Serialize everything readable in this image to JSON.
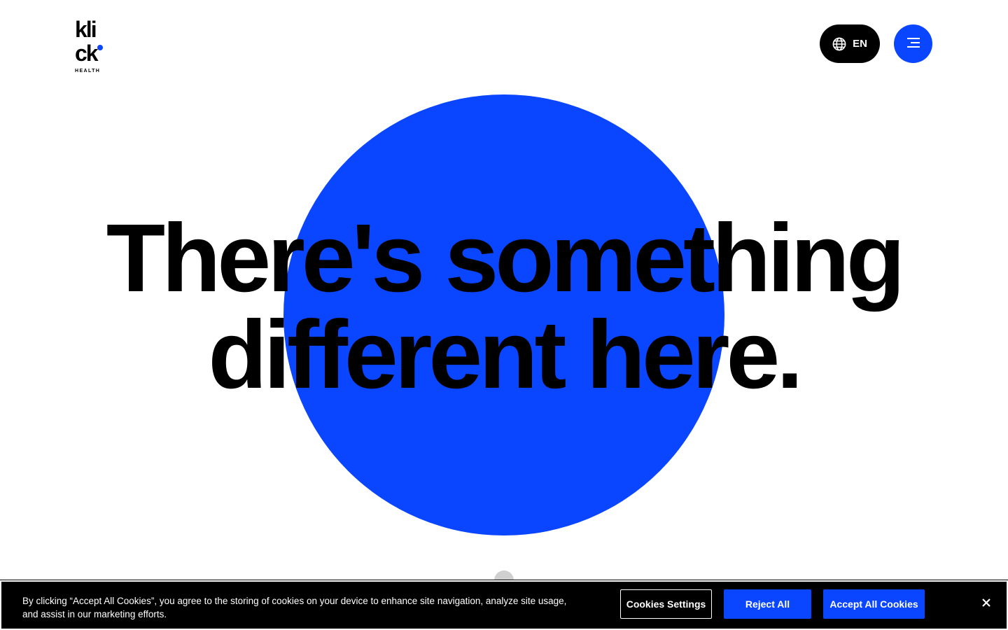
{
  "header": {
    "logo": {
      "top": "kli",
      "bottom": "ck",
      "sub": "HEALTH"
    },
    "language_label": "EN",
    "language_icon": "globe-icon",
    "menu_icon": "hamburger-menu-icon"
  },
  "hero": {
    "line1": "There's something",
    "line2": "different here."
  },
  "cookie_banner": {
    "text": "By clicking “Accept All Cookies”, you agree to the storing of cookies on your device to enhance site navigation, analyze site usage, and assist in our marketing efforts.",
    "settings_label": "Cookies Settings",
    "reject_label": "Reject All",
    "accept_label": "Accept All Cookies",
    "close_icon": "close-icon"
  },
  "colors": {
    "accent": "#0a45ff",
    "text": "#000000",
    "background": "#ffffff",
    "scroll_indicator": "#cfcfcf"
  }
}
